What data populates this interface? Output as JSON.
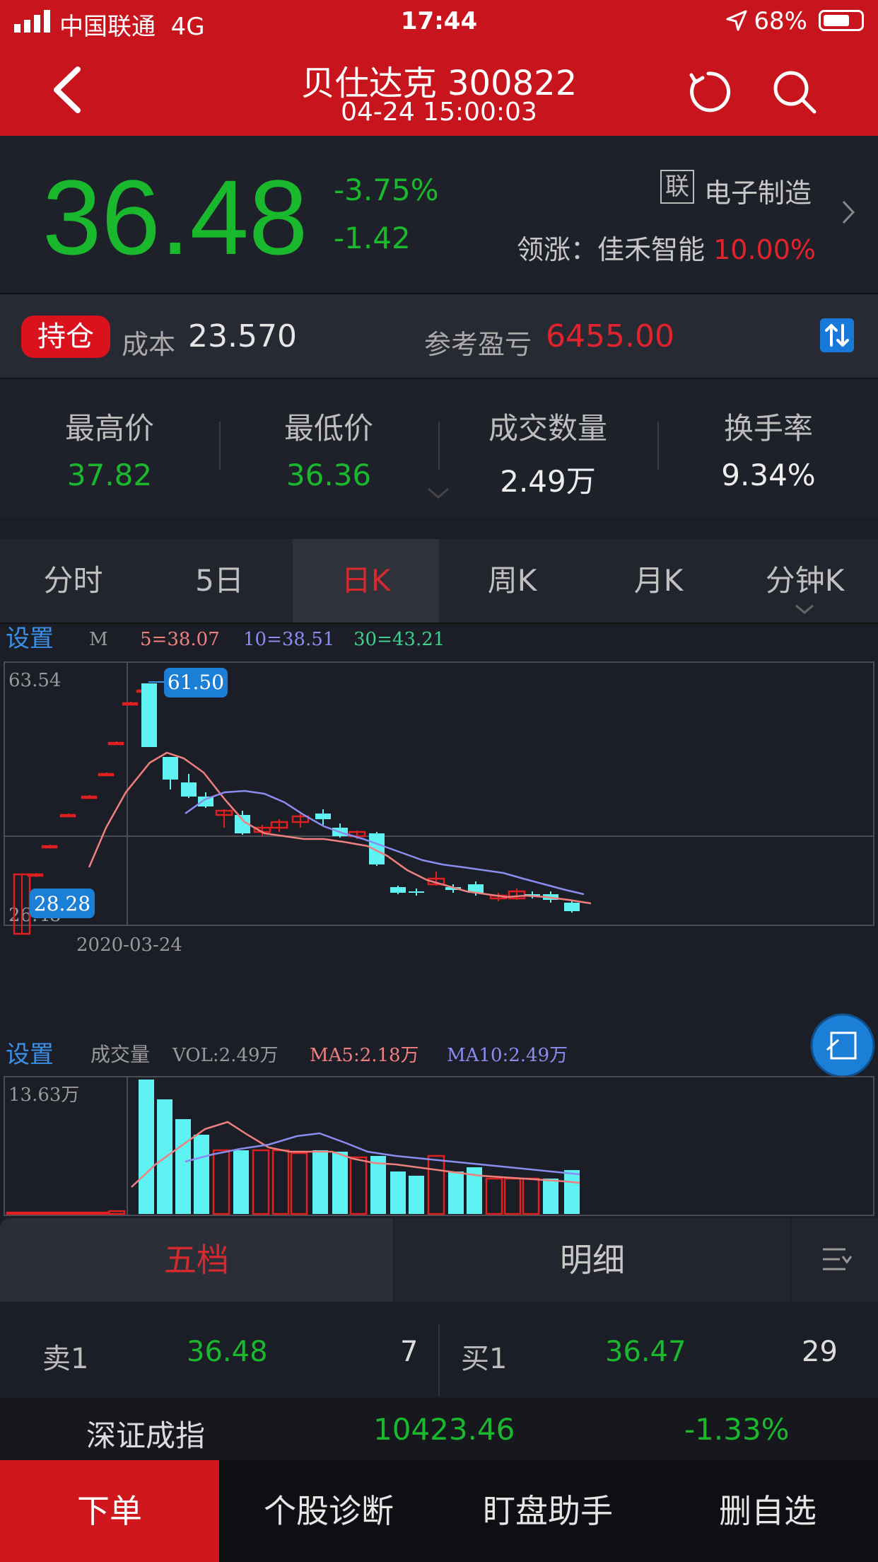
{
  "status_bar": {
    "carrier": "中国联通",
    "network": "4G",
    "time": "17:44",
    "battery": "68%"
  },
  "nav": {
    "title": "贝仕达克 300822",
    "subtitle": "04-24 15:00:03"
  },
  "quote": {
    "price": "36.48",
    "change_pct": "-3.75%",
    "change": "-1.42",
    "lian_badge": "联",
    "sector": "电子制造",
    "leader_label": "领涨：佳禾智能",
    "leader_pct": "10.00%"
  },
  "position": {
    "tag": "持仓",
    "cost_label": "成本",
    "cost_value": "23.570",
    "pl_label": "参考盈亏",
    "pl_value": "6455.00"
  },
  "stats": [
    {
      "label": "最高价",
      "value": "37.82"
    },
    {
      "label": "最低价",
      "value": "36.36"
    },
    {
      "label": "成交数量",
      "value": "2.49万"
    },
    {
      "label": "换手率",
      "value": "9.34%"
    }
  ],
  "period_tabs": [
    "分时",
    "5日",
    "日K",
    "周K",
    "月K",
    "分钟K"
  ],
  "kline": {
    "settings": "设置",
    "m_label": "M",
    "ma5": "5=38.07",
    "ma10": "10=38.51",
    "ma30": "30=43.21",
    "top_price": "63.54",
    "bottom_price": "26.48",
    "high_mark": "61.50",
    "low_mark": "28.28",
    "date_label": "2020-03-24",
    "colors": {
      "up": "#e02020",
      "down": "#5ff2f2",
      "ma5": "#f08080",
      "ma10": "#8a8cf0",
      "ma30": "#3fcf8e"
    }
  },
  "volume": {
    "settings": "设置",
    "label": "成交量",
    "vol": "VOL:2.49万",
    "ma5": "MA5:2.18万",
    "ma10": "MA10:2.49万",
    "top_value": "13.63万"
  },
  "book_tabs": {
    "five": "五档",
    "detail": "明细"
  },
  "order_book": {
    "sell1_label": "卖1",
    "sell1_price": "36.48",
    "sell1_vol": "7",
    "buy1_label": "买1",
    "buy1_price": "36.47",
    "buy1_vol": "29"
  },
  "index": {
    "name": "深证成指",
    "value": "10423.46",
    "pct": "-1.33%"
  },
  "actions": [
    "下单",
    "个股诊断",
    "盯盘助手",
    "删自选"
  ]
}
